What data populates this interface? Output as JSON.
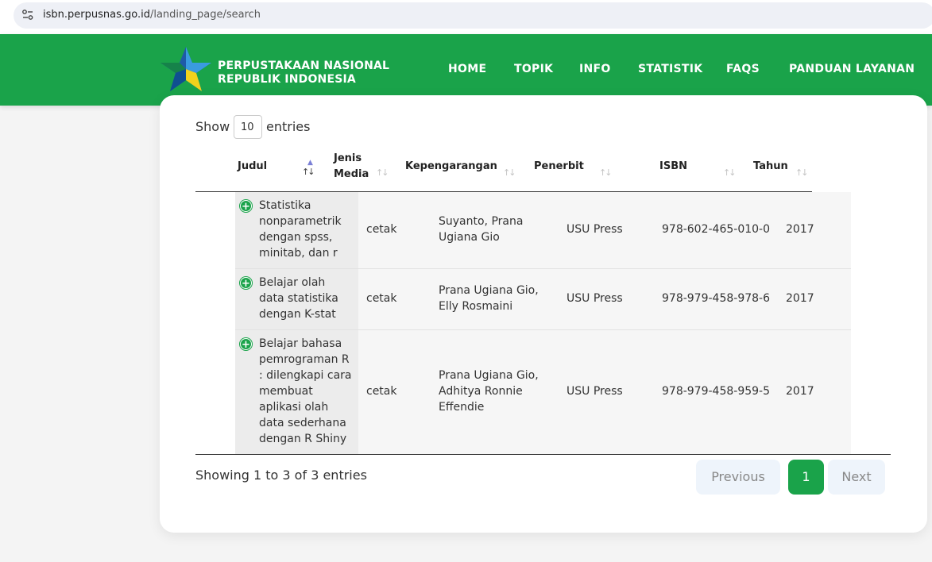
{
  "browser": {
    "url_host": "isbn.perpusnas.go.id",
    "url_path": "/landing_page/search"
  },
  "header": {
    "brand_line1": "PERPUSTAKAAN NASIONAL",
    "brand_line2": "REPUBLIK INDONESIA",
    "menu": [
      "HOME",
      "TOPIK",
      "INFO",
      "STATISTIK",
      "FAQS",
      "PANDUAN LAYANAN"
    ]
  },
  "table_controls": {
    "show_label": "Show",
    "entries_value": "10",
    "entries_label": "entries"
  },
  "table": {
    "columns": [
      "Judul",
      "Jenis\nMedia",
      "Kepengarangan",
      "Penerbit",
      "ISBN",
      "Tahun"
    ],
    "rows": [
      {
        "judul": "Statistika\nnonparametrik\ndengan spss,\nminitab, dan r",
        "jenis_media": "cetak",
        "kepengarangan": "Suyanto, Prana\nUgiana Gio",
        "penerbit": "USU Press",
        "isbn": "978-602-465-010-0",
        "tahun": "2017"
      },
      {
        "judul": "Belajar olah\ndata statistika\ndengan K-stat",
        "jenis_media": "cetak",
        "kepengarangan": "Prana Ugiana Gio,\nElly Rosmaini",
        "penerbit": "USU Press",
        "isbn": "978-979-458-978-6",
        "tahun": "2017"
      },
      {
        "judul": "Belajar bahasa\npemrograman R\n: dilengkapi cara\nmembuat\naplikasi olah\ndata sederhana\ndengan R Shiny",
        "jenis_media": "cetak",
        "kepengarangan": "Prana Ugiana Gio,\nAdhitya Ronnie\nEffendie",
        "penerbit": "USU Press",
        "isbn": "978-979-458-959-5",
        "tahun": "2017"
      }
    ]
  },
  "footer": {
    "info": "Showing 1 to 3 of 3 entries",
    "prev": "Previous",
    "page": "1",
    "next": "Next"
  },
  "colors": {
    "brand_green": "#1aa34a",
    "sort_active": "#7b80d6"
  }
}
